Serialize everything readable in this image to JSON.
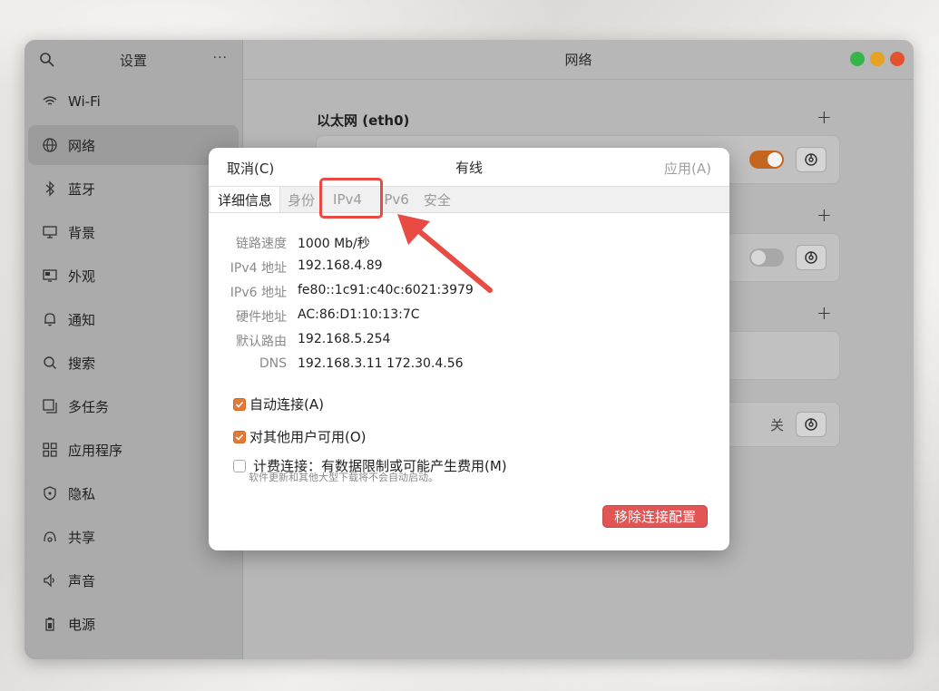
{
  "sidebar": {
    "title": "设置",
    "menu_label": "···",
    "items": [
      {
        "label": "Wi-Fi",
        "icon": "wifi-icon"
      },
      {
        "label": "网络",
        "icon": "globe-icon",
        "active": true
      },
      {
        "label": "蓝牙",
        "icon": "bluetooth-icon"
      },
      {
        "label": "背景",
        "icon": "monitor-icon"
      },
      {
        "label": "外观",
        "icon": "appearance-icon"
      },
      {
        "label": "通知",
        "icon": "bell-icon"
      },
      {
        "label": "搜索",
        "icon": "search-icon"
      },
      {
        "label": "多任务",
        "icon": "multitask-icon"
      },
      {
        "label": "应用程序",
        "icon": "apps-icon"
      },
      {
        "label": "隐私",
        "icon": "shield-icon"
      },
      {
        "label": "共享",
        "icon": "share-icon"
      },
      {
        "label": "声音",
        "icon": "speaker-icon"
      },
      {
        "label": "电源",
        "icon": "battery-icon"
      }
    ]
  },
  "main": {
    "title": "网络",
    "ethernet_title": "以太网 (eth0)",
    "plus_label": "+",
    "off_label": "关"
  },
  "dialog": {
    "cancel_label": "取消(C)",
    "title": "有线",
    "apply_label": "应用(A)",
    "tabs": [
      "详细信息",
      "身份",
      "IPv4",
      "IPv6",
      "安全"
    ],
    "details": [
      {
        "label": "链路速度",
        "value": "1000 Mb/秒"
      },
      {
        "label": "IPv4 地址",
        "value": "192.168.4.89"
      },
      {
        "label": "IPv6 地址",
        "value": "fe80::1c91:c40c:6021:3979"
      },
      {
        "label": "硬件地址",
        "value": "AC:86:D1:10:13:7C"
      },
      {
        "label": "默认路由",
        "value": "192.168.5.254"
      },
      {
        "label": "DNS",
        "value": "192.168.3.11 172.30.4.56"
      }
    ],
    "auto_connect_label": "自动连接(A)",
    "all_users_label": "对其他用户可用(O)",
    "metered_label": "计费连接：有数据限制或可能产生费用(M)",
    "metered_note": "软件更新和其他大型下载将不会自动启动。",
    "remove_label": "移除连接配置"
  },
  "colors": {
    "accent": "#e07a36",
    "danger": "#e25555",
    "highlight": "#e84a44",
    "close": "#e2522f",
    "minimize": "#e5a321",
    "maximize": "#38b54a"
  }
}
